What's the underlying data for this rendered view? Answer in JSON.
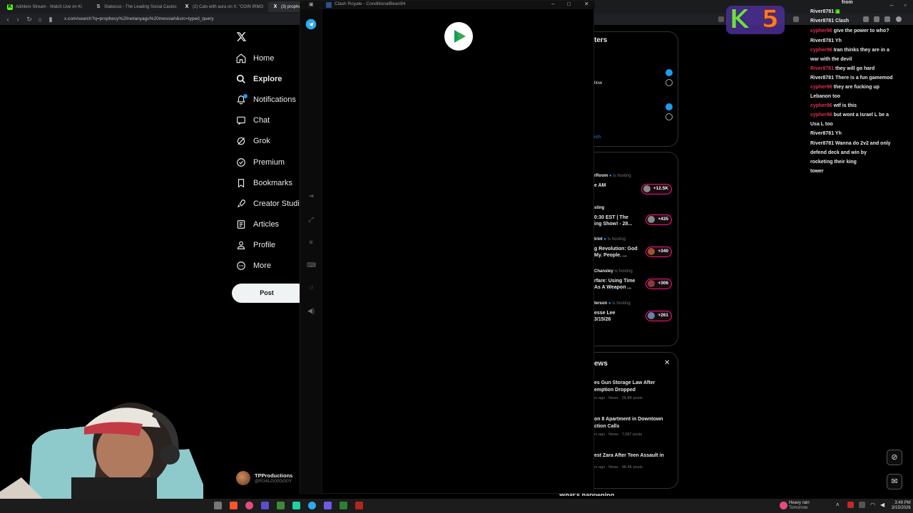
{
  "browser": {
    "tabs": [
      {
        "label": "Adinlerx Stream - Watch Live on Ki",
        "color": "#53fc18",
        "glyph": "K"
      },
      {
        "label": "Stakecus - The Leading Social Casino",
        "color": "#cccccc",
        "glyph": "S"
      },
      {
        "label": "(2) Cats with aura on X: \"COIN IRMO",
        "color": "#ffffff",
        "glyph": "X"
      },
      {
        "label": "(3) prophec",
        "color": "#ffffff",
        "glyph": "X"
      }
    ],
    "url": "x.com/search?q=prophecy%20netanyagu%20messiah&src=typed_query"
  },
  "x_nav": {
    "items": [
      {
        "label": "Home",
        "icon": "home-icon",
        "bold": false
      },
      {
        "label": "Explore",
        "icon": "search-icon",
        "bold": true
      },
      {
        "label": "Notifications",
        "icon": "bell-icon",
        "bold": false
      },
      {
        "label": "Chat",
        "icon": "chat-icon",
        "bold": false
      },
      {
        "label": "Grok",
        "icon": "grok-icon",
        "bold": false
      },
      {
        "label": "Premium",
        "icon": "premium-icon",
        "bold": false
      },
      {
        "label": "Bookmarks",
        "icon": "bookmark-icon",
        "bold": false
      },
      {
        "label": "Creator Studio",
        "icon": "rocket-icon",
        "bold": false
      },
      {
        "label": "Articles",
        "icon": "article-icon",
        "bold": false
      },
      {
        "label": "Profile",
        "icon": "person-icon",
        "bold": false
      },
      {
        "label": "More",
        "icon": "more-icon",
        "bold": false
      }
    ],
    "post_label": "Post",
    "account": {
      "name": "TPProductions",
      "handle": "@R34LG00DG0Y"
    }
  },
  "game_window": {
    "title": "Clash Royale - ConditionalBean94"
  },
  "sidebar": {
    "filters": {
      "title": "ters",
      "follow_text": "llow",
      "search_link": "rch"
    },
    "spaces": [
      {
        "host": "rRoom",
        "title": "e AM",
        "listeners": "+12.5K"
      },
      {
        "host": "sting",
        "title": "0:30 EST | The\ning Show! - 28...",
        "listeners": "+435"
      },
      {
        "host": "triot",
        "title": "g Revolution: God\nMy. People. ...",
        "listeners": "+340"
      },
      {
        "host": "Chansley",
        "title": "rfare: Using Time\nAs A Weapon ...",
        "listeners": "+306"
      },
      {
        "host": "terson",
        "title": "esse Lee\n3/15/26",
        "listeners": "+261"
      }
    ],
    "hosting_label": "is hosting",
    "news": {
      "title": "ews",
      "items": [
        {
          "headline": "es Gun Storage Law After\nemption Dropped",
          "meta": "rs ago · News · 26.8K posts"
        },
        {
          "headline": "on 8 Apartment in Downtown\nction Calls",
          "meta": "rs ago · News · 7,687 posts"
        },
        {
          "headline": "est Zara After Teen Assault in",
          "meta": "rs ago · News · 48.4K posts"
        }
      ]
    },
    "bottom_cut": "What's happening"
  },
  "chat": {
    "lines": [
      {
        "user": "",
        "msg": "from",
        "red": false
      },
      {
        "user": "River8781",
        "msg": "",
        "red": false
      },
      {
        "user": "River8781",
        "msg": "Clash",
        "red": false
      },
      {
        "user": "cypher96",
        "msg": "give the power to who?",
        "red": true
      },
      {
        "user": "River8781",
        "msg": "Yh",
        "red": false
      },
      {
        "user": "cypher96",
        "msg": "Iran thinks they are in a\nwar with the devil",
        "red": true
      },
      {
        "user": "River8781",
        "msg": "they will go hard",
        "red": false
      },
      {
        "user": "River8781",
        "msg": "There is a fun gamemod",
        "red": false
      },
      {
        "user": "cypher96",
        "msg": "they are fucking up\nLebanon too",
        "red": true
      },
      {
        "user": "cypher96",
        "msg": "wtf is this",
        "red": true
      },
      {
        "user": "cypher96",
        "msg": "but wont a Israel L be a\nUsa L too",
        "red": true
      },
      {
        "user": "River8781",
        "msg": "Yh",
        "red": false
      },
      {
        "user": "River8781",
        "msg": "Wanna do 2v2 and only\ndefend deck and win by\nrocketing their king\ntower",
        "red": false
      }
    ]
  },
  "overlay": {
    "k_letter": "K",
    "k_number": "5"
  },
  "taskbar": {
    "weather": "Heavy rain",
    "weather_sub": "Tomorrow",
    "time": "3:49 PM",
    "date": "3/15/2026"
  },
  "colors": {
    "x_blue": "#1d9bf0",
    "live_pink": "#f91880",
    "chat_red": "#e0304d"
  }
}
